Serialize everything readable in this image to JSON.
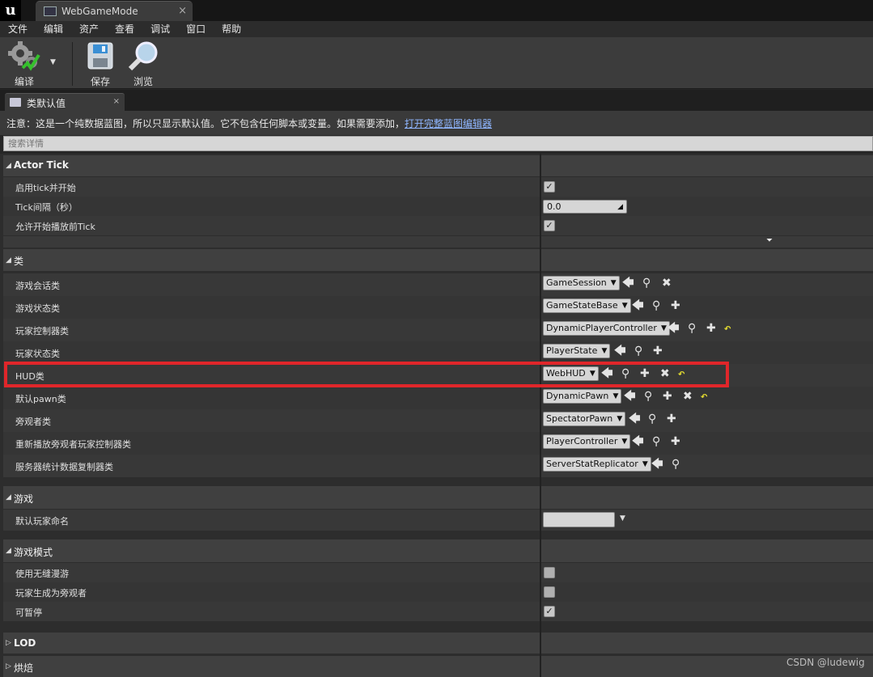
{
  "window": {
    "tab_title": "WebGameMode",
    "close_glyph": "×"
  },
  "menu": [
    "文件",
    "编辑",
    "资产",
    "查看",
    "调试",
    "窗口",
    "帮助"
  ],
  "toolbar": {
    "compile": "编译",
    "save": "保存",
    "browse": "浏览"
  },
  "panel": {
    "tab": "类默认值",
    "close_glyph": "×"
  },
  "notice": {
    "text": "注意：这是一个纯数据蓝图，所以只显示默认值。它不包含任何脚本或变量。如果需要添加，",
    "link": "打开完整蓝图编辑器"
  },
  "search": {
    "placeholder": "搜索详情"
  },
  "sections": {
    "actor_tick": {
      "title": "Actor Tick",
      "rows": {
        "start_with_tick": "启用tick并开始",
        "tick_interval": "Tick间隔（秒）",
        "tick_before_begin": "允许开始播放前Tick"
      },
      "tick_interval_value": "0.0",
      "start_with_tick_checked": true,
      "tick_before_begin_checked": true
    },
    "classes": {
      "title": "类",
      "rows": [
        {
          "label": "游戏会话类",
          "value": "GameSession",
          "buttons": [
            "use",
            "browse",
            "clear"
          ],
          "reset": false
        },
        {
          "label": "游戏状态类",
          "value": "GameStateBase",
          "buttons": [
            "use",
            "browse",
            "new"
          ],
          "reset": false
        },
        {
          "label": "玩家控制器类",
          "value": "DynamicPlayerController",
          "buttons": [
            "use",
            "browse",
            "new"
          ],
          "reset": true
        },
        {
          "label": "玩家状态类",
          "value": "PlayerState",
          "buttons": [
            "use",
            "browse",
            "new"
          ],
          "reset": false
        },
        {
          "label": "HUD类",
          "value": "WebHUD",
          "buttons": [
            "use",
            "browse",
            "new",
            "clear"
          ],
          "reset": true
        },
        {
          "label": "默认pawn类",
          "value": "DynamicPawn",
          "buttons": [
            "use",
            "browse",
            "new",
            "clear"
          ],
          "reset": true
        },
        {
          "label": "旁观者类",
          "value": "SpectatorPawn",
          "buttons": [
            "use",
            "browse",
            "new"
          ],
          "reset": false
        },
        {
          "label": "重新播放旁观者玩家控制器类",
          "value": "PlayerController",
          "buttons": [
            "use",
            "browse",
            "new"
          ],
          "reset": false
        },
        {
          "label": "服务器统计数据复制器类",
          "value": "ServerStatReplicator",
          "buttons": [
            "use",
            "browse"
          ],
          "reset": false
        }
      ]
    },
    "game": {
      "title": "游戏",
      "rows": {
        "default_player_name": "默认玩家命名"
      }
    },
    "game_mode": {
      "title": "游戏模式",
      "rows": {
        "seamless_travel": "使用无缝漫游",
        "start_spectator": "玩家生成为旁观者",
        "pausable": "可暂停"
      },
      "seamless_checked": false,
      "spectator_checked": false,
      "pausable_checked": true
    },
    "lod": {
      "title": "LOD"
    },
    "bake": {
      "title": "烘焙"
    }
  },
  "watermark": "CSDN @ludewig",
  "highlight_color": "#e0262a"
}
